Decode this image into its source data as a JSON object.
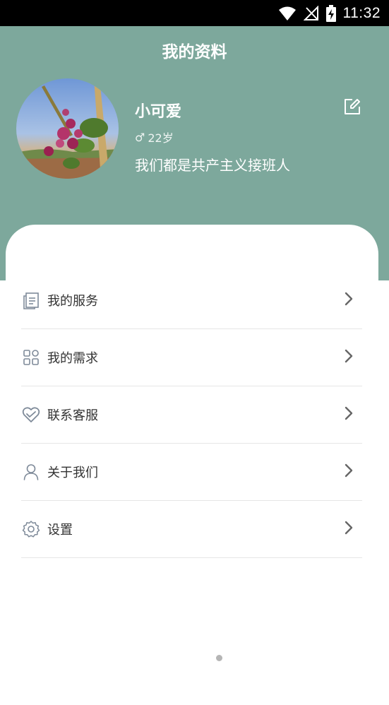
{
  "status_bar": {
    "time": "11:32"
  },
  "header": {
    "title": "我的资料"
  },
  "profile": {
    "name": "小可爱",
    "gender_symbol": "♂",
    "age": "22岁",
    "motto": "我们都是共产主义接班人"
  },
  "menu": [
    {
      "label": "我的服务",
      "icon": "document-icon"
    },
    {
      "label": "我的需求",
      "icon": "grid-icon"
    },
    {
      "label": "联系客服",
      "icon": "heart-icon"
    },
    {
      "label": "关于我们",
      "icon": "person-icon"
    },
    {
      "label": "设置",
      "icon": "gear-icon"
    }
  ],
  "colors": {
    "header_bg": "#7da89c",
    "icon": "#7e8a99",
    "chevron": "#666666"
  }
}
